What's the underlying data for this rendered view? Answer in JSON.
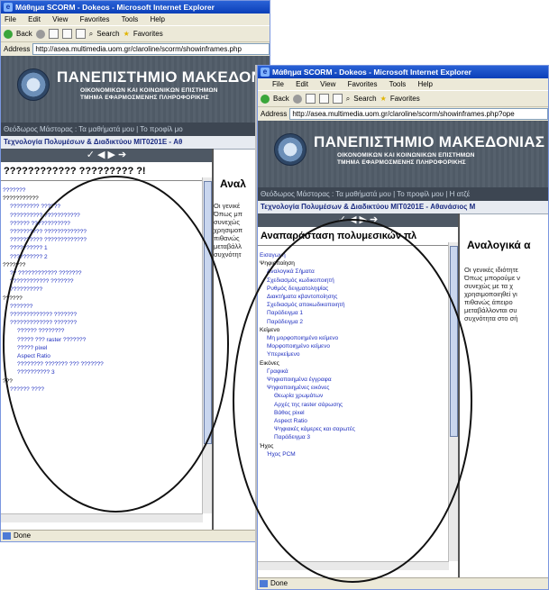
{
  "window_back": {
    "title": "Μάθημα SCORM - Dokeos - Microsoft Internet Explorer",
    "menu": [
      "File",
      "Edit",
      "View",
      "Favorites",
      "Tools",
      "Help"
    ],
    "toolbar": {
      "back": "Back",
      "search": "Search",
      "favorites": "Favorites"
    },
    "address_label": "Address",
    "address_url": "http://asea.multimedia.uom.gr/claroline/scorm/showinframes.php",
    "university": "ΠΑΝΕΠΙΣΤΗΜΙΟ ΜΑΚΕΔΟΝΙΑΣ",
    "faculty_line1": "ΟΙΚΟΝΟΜΙΚΩΝ ΚΑΙ ΚΟΙΝΩΝΙΚΩΝ ΕΠΙΣΤΗΜΩΝ",
    "faculty_line2": "ΤΜΗΜΑ ΕΦΑΡΜΟΣΜΕΝΗΣ ΠΛΗΡΟΦΟΡΙΚΗΣ",
    "nav": "Θεόδωρος Μάστορας : Τα μαθήματά μου | Το προφίλ μο",
    "course": "Τεχνολογία Πολυμέσων & Διαδικτύου MIT0201E - Αθ",
    "arrows": "✓  ◀  ▶  ➔",
    "toc_title": "???????????? ????????? ?!",
    "right_title": "Αναλ",
    "right_text": [
      "Οι γενικέ",
      "Όπως μπ",
      "συνεχώς",
      "χρησιμοπ",
      "πιθανώς",
      "μεταβάλλ",
      "συχνότητ"
    ],
    "toc": [
      {
        "text": "???????",
        "indent": 0,
        "link": true
      },
      {
        "text": "???????????",
        "indent": 0,
        "link": false
      },
      {
        "text": "????????? ??????",
        "indent": 1,
        "link": true
      },
      {
        "text": "?????????? ???????????",
        "indent": 1,
        "link": true
      },
      {
        "text": "?????? ????????????",
        "indent": 1,
        "link": true
      },
      {
        "text": "?????????? ?????????????",
        "indent": 1,
        "link": true
      },
      {
        "text": "?????????? ?????????????",
        "indent": 1,
        "link": true
      },
      {
        "text": "?????????? 1",
        "indent": 1,
        "link": true
      },
      {
        "text": "?????????? 2",
        "indent": 1,
        "link": true
      },
      {
        "text": "???????",
        "indent": 0,
        "link": false
      },
      {
        "text": "?? ???????????? ???????",
        "indent": 1,
        "link": true
      },
      {
        "text": "???????????? ???????",
        "indent": 1,
        "link": true
      },
      {
        "text": "??????????",
        "indent": 1,
        "link": true
      },
      {
        "text": "??????",
        "indent": 0,
        "link": false
      },
      {
        "text": "???????",
        "indent": 1,
        "link": true
      },
      {
        "text": "????????????? ???????",
        "indent": 1,
        "link": true
      },
      {
        "text": "????????????? ???????",
        "indent": 1,
        "link": true
      },
      {
        "text": "?????? ????????",
        "indent": 2,
        "link": true
      },
      {
        "text": "????? ??? raster ???????",
        "indent": 2,
        "link": true
      },
      {
        "text": "????? pixel",
        "indent": 2,
        "link": true
      },
      {
        "text": "Aspect Ratio",
        "indent": 2,
        "link": true
      },
      {
        "text": "???????? ??????? ??? ???????",
        "indent": 2,
        "link": true
      },
      {
        "text": "?????????? 3",
        "indent": 2,
        "link": true
      },
      {
        "text": "???",
        "indent": 0,
        "link": false
      },
      {
        "text": "?????? ????",
        "indent": 1,
        "link": true
      }
    ],
    "status": "Done"
  },
  "window_front": {
    "title": "Μάθημα SCORM - Dokeos - Microsoft Internet Explorer",
    "menu": [
      "File",
      "Edit",
      "View",
      "Favorites",
      "Tools",
      "Help"
    ],
    "toolbar": {
      "back": "Back",
      "search": "Search",
      "favorites": "Favorites"
    },
    "address_label": "Address",
    "address_url": "http://asea.multimedia.uom.gr/claroline/scorm/showinframes.php?ope",
    "university": "ΠΑΝΕΠΙΣΤΗΜΙΟ ΜΑΚΕΔΟΝΙΑΣ",
    "faculty_line1": "ΟΙΚΟΝΟΜΙΚΩΝ ΚΑΙ ΚΟΙΝΩΝΙΚΩΝ ΕΠΙΣΤΗΜΩΝ",
    "faculty_line2": "ΤΜΗΜΑ ΕΦΑΡΜΟΣΜΕΝΗΣ ΠΛΗΡΟΦΟΡΙΚΗΣ",
    "nav": "Θεόδωρος Μάστορας : Τα μαθήματά μου | Το προφίλ μου | Η ατζέ",
    "course": "Τεχνολογία Πολυμέσων & Διαδικτύου MIT0201E - Αθανάσιος Μ",
    "arrows": "✓  ◀  ▶  ➔",
    "toc_title": "Αναπαράσταση πολυμεσικών πλ",
    "right_title": "Αναλογικά α",
    "right_text": [
      "Οι γενικές ιδιότητε",
      "Όπως μπορούμε ν",
      "συνεχώς με τα χ",
      "χρησιμοποιηθεί γι",
      "πιθανώς άπειρο",
      "μεταβάλλονται συ",
      "συχνότητα στο σή"
    ],
    "toc": [
      {
        "text": "Εισαγωγή",
        "indent": 0,
        "link": true
      },
      {
        "text": "Ψηφιοποίηση",
        "indent": 0,
        "link": false
      },
      {
        "text": "Αναλογικά Σήματα",
        "indent": 1,
        "link": true
      },
      {
        "text": "Σχεδιασμός κωδικοποιητή",
        "indent": 1,
        "link": true
      },
      {
        "text": "Ρυθμός δειγματοληψίας",
        "indent": 1,
        "link": true
      },
      {
        "text": "Διακτήματα κβαντοποίησης",
        "indent": 1,
        "link": true
      },
      {
        "text": "Σχεδιασμός αποκωδικοποιητή",
        "indent": 1,
        "link": true
      },
      {
        "text": "Παράδειγμα 1",
        "indent": 1,
        "link": true
      },
      {
        "text": "Παράδειγμα 2",
        "indent": 1,
        "link": true
      },
      {
        "text": "Κείμενο",
        "indent": 0,
        "link": false
      },
      {
        "text": "Μη μορφοποιημένο κείμενο",
        "indent": 1,
        "link": true
      },
      {
        "text": "Μορφοποιημένο κείμενο",
        "indent": 1,
        "link": true
      },
      {
        "text": "Υπερκείμενο",
        "indent": 1,
        "link": true
      },
      {
        "text": "Εικόνες",
        "indent": 0,
        "link": false
      },
      {
        "text": "Γραφικά",
        "indent": 1,
        "link": true
      },
      {
        "text": "Ψηφιοποιημένα έγγραφα",
        "indent": 1,
        "link": true
      },
      {
        "text": "Ψηφιοποιημένες εικόνες",
        "indent": 1,
        "link": true
      },
      {
        "text": "Θεωρία χρωμάτων",
        "indent": 2,
        "link": true
      },
      {
        "text": "Αρχές της raster σάρωσης",
        "indent": 2,
        "link": true
      },
      {
        "text": "Βάθος pixel",
        "indent": 2,
        "link": true
      },
      {
        "text": "Aspect Ratio",
        "indent": 2,
        "link": true
      },
      {
        "text": "Ψηφιακές κάμερες και σαρωτές",
        "indent": 2,
        "link": true
      },
      {
        "text": "Παράδειγμα 3",
        "indent": 2,
        "link": true
      },
      {
        "text": "Ήχος",
        "indent": 0,
        "link": false
      },
      {
        "text": "Ήχος PCM",
        "indent": 1,
        "link": true
      }
    ],
    "status": "Done"
  }
}
